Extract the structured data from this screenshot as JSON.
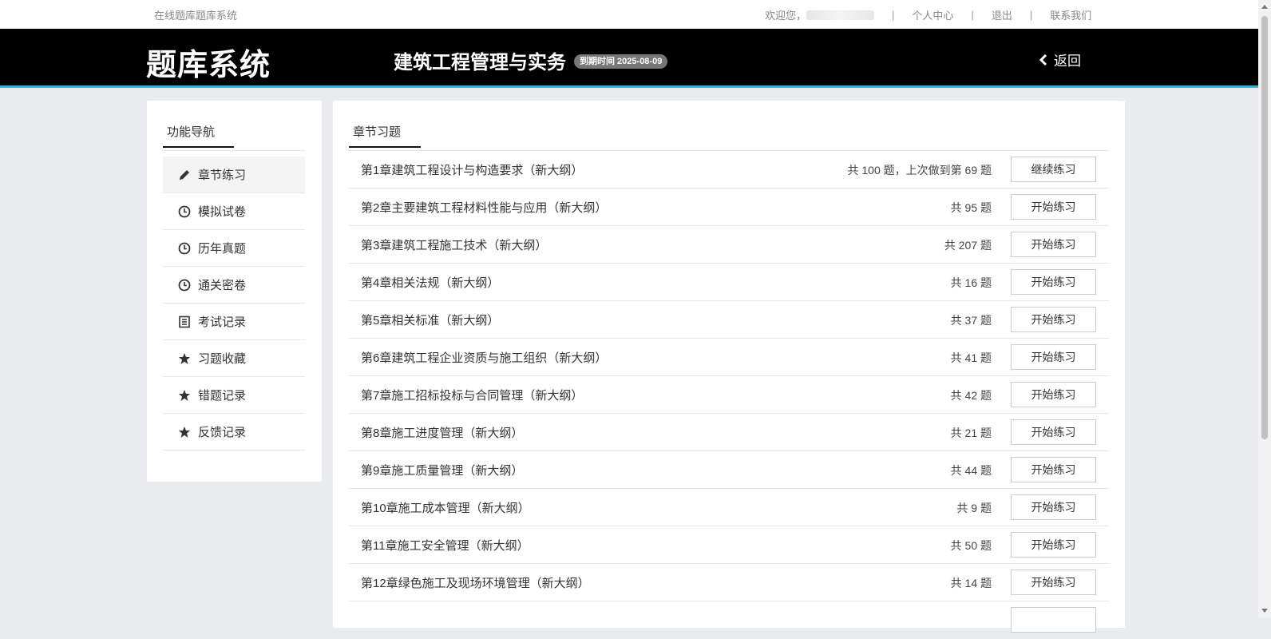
{
  "topbar": {
    "site_name": "在线题库题库系统",
    "welcome": "欢迎您，",
    "separator": "|",
    "links": [
      "个人中心",
      "退出",
      "联系我们"
    ]
  },
  "header": {
    "logo": "题库系统",
    "subject": "建筑工程管理与实务",
    "expire_badge": "到期时间 2025-08-09",
    "back_label": "返回"
  },
  "sidebar": {
    "title": "功能导航",
    "items": [
      {
        "label": "章节练习",
        "icon": "pencil-icon",
        "active": true
      },
      {
        "label": "模拟试卷",
        "icon": "clock-icon"
      },
      {
        "label": "历年真题",
        "icon": "clock-icon"
      },
      {
        "label": "通关密卷",
        "icon": "clock-icon"
      },
      {
        "label": "考试记录",
        "icon": "list-icon"
      },
      {
        "label": "习题收藏",
        "icon": "star-icon"
      },
      {
        "label": "错题记录",
        "icon": "star-icon"
      },
      {
        "label": "反馈记录",
        "icon": "star-icon"
      }
    ]
  },
  "main": {
    "title": "章节习题",
    "chapters": [
      {
        "name": "第1章建筑工程设计与构造要求（新大纲）",
        "count": "共 100 题，上次做到第 69 题",
        "button": "继续练习"
      },
      {
        "name": "第2章主要建筑工程材料性能与应用（新大纲）",
        "count": "共 95 题",
        "button": "开始练习"
      },
      {
        "name": "第3章建筑工程施工技术（新大纲）",
        "count": "共 207 题",
        "button": "开始练习"
      },
      {
        "name": "第4章相关法规（新大纲）",
        "count": "共 16 题",
        "button": "开始练习"
      },
      {
        "name": "第5章相关标准（新大纲）",
        "count": "共 37 题",
        "button": "开始练习"
      },
      {
        "name": "第6章建筑工程企业资质与施工组织（新大纲）",
        "count": "共 41 题",
        "button": "开始练习"
      },
      {
        "name": "第7章施工招标投标与合同管理（新大纲）",
        "count": "共 42 题",
        "button": "开始练习"
      },
      {
        "name": "第8章施工进度管理（新大纲）",
        "count": "共 21 题",
        "button": "开始练习"
      },
      {
        "name": "第9章施工质量管理（新大纲）",
        "count": "共 44 题",
        "button": "开始练习"
      },
      {
        "name": "第10章施工成本管理（新大纲）",
        "count": "共 9 题",
        "button": "开始练习"
      },
      {
        "name": "第11章施工安全管理（新大纲）",
        "count": "共 50 题",
        "button": "开始练习"
      },
      {
        "name": "第12章绿色施工及现场环境管理（新大纲）",
        "count": "共 14 题",
        "button": "开始练习"
      }
    ]
  },
  "colors": {
    "header_bg": "#000000",
    "header_accent": "#29b6d6",
    "page_bg": "#e9ebee"
  }
}
